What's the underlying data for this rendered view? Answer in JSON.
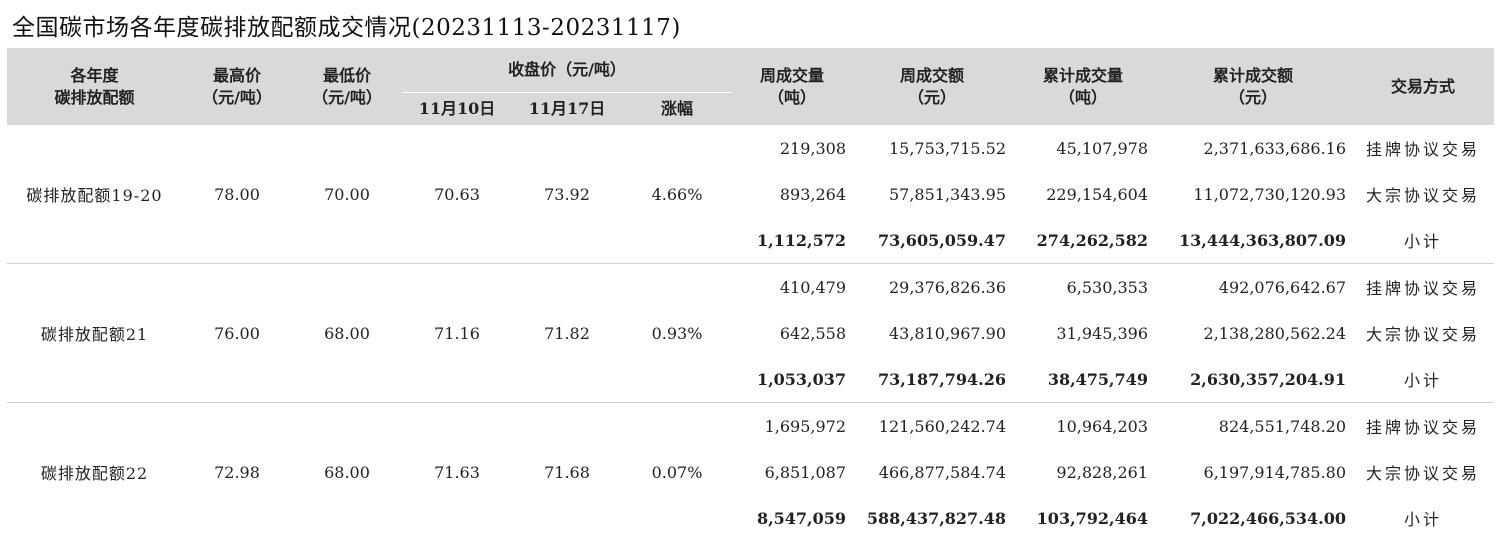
{
  "title": "全国碳市场各年度碳排放配额成交情况(20231113-20231117)",
  "headers": {
    "category_line1": "各年度",
    "category_line2": "碳排放配额",
    "high_line1": "最高价",
    "high_line2": "（元/吨）",
    "low_line1": "最低价",
    "low_line2": "（元/吨）",
    "close_group": "收盘价（元/吨）",
    "close_d1": "11月10日",
    "close_d2": "11月17日",
    "change": "涨幅",
    "wk_vol_line1": "周成交量",
    "wk_vol_line2": "（吨）",
    "wk_amt_line1": "周成交额",
    "wk_amt_line2": "（元）",
    "cum_vol_line1": "累计成交量",
    "cum_vol_line2": "（吨）",
    "cum_amt_line1": "累计成交额",
    "cum_amt_line2": "（元）",
    "method": "交易方式"
  },
  "groups": [
    {
      "name": "碳排放配额19-20",
      "high": "78.00",
      "low": "70.00",
      "close_d1": "70.63",
      "close_d2": "73.92",
      "change": "4.66%",
      "rows": [
        {
          "wk_vol": "219,308",
          "wk_amt": "15,753,715.52",
          "cum_vol": "45,107,978",
          "cum_amt": "2,371,633,686.16",
          "method": "挂牌协议交易"
        },
        {
          "wk_vol": "893,264",
          "wk_amt": "57,851,343.95",
          "cum_vol": "229,154,604",
          "cum_amt": "11,072,730,120.93",
          "method": "大宗协议交易"
        },
        {
          "wk_vol": "1,112,572",
          "wk_amt": "73,605,059.47",
          "cum_vol": "274,262,582",
          "cum_amt": "13,444,363,807.09",
          "method": "小计"
        }
      ]
    },
    {
      "name": "碳排放配额21",
      "high": "76.00",
      "low": "68.00",
      "close_d1": "71.16",
      "close_d2": "71.82",
      "change": "0.93%",
      "rows": [
        {
          "wk_vol": "410,479",
          "wk_amt": "29,376,826.36",
          "cum_vol": "6,530,353",
          "cum_amt": "492,076,642.67",
          "method": "挂牌协议交易"
        },
        {
          "wk_vol": "642,558",
          "wk_amt": "43,810,967.90",
          "cum_vol": "31,945,396",
          "cum_amt": "2,138,280,562.24",
          "method": "大宗协议交易"
        },
        {
          "wk_vol": "1,053,037",
          "wk_amt": "73,187,794.26",
          "cum_vol": "38,475,749",
          "cum_amt": "2,630,357,204.91",
          "method": "小计"
        }
      ]
    },
    {
      "name": "碳排放配额22",
      "high": "72.98",
      "low": "68.00",
      "close_d1": "71.63",
      "close_d2": "71.68",
      "change": "0.07%",
      "rows": [
        {
          "wk_vol": "1,695,972",
          "wk_amt": "121,560,242.74",
          "cum_vol": "10,964,203",
          "cum_amt": "824,551,748.20",
          "method": "挂牌协议交易"
        },
        {
          "wk_vol": "6,851,087",
          "wk_amt": "466,877,584.74",
          "cum_vol": "92,828,261",
          "cum_amt": "6,197,914,785.80",
          "method": "大宗协议交易"
        },
        {
          "wk_vol": "8,547,059",
          "wk_amt": "588,437,827.48",
          "cum_vol": "103,792,464",
          "cum_amt": "7,022,466,534.00",
          "method": "小计"
        }
      ]
    }
  ]
}
